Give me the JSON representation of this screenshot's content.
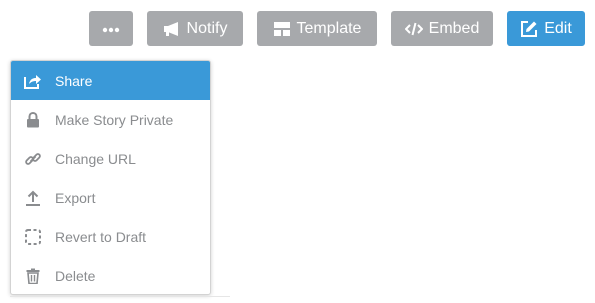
{
  "toolbar": {
    "more_icon": "ellipsis-icon",
    "notify": {
      "label": "Notify",
      "icon": "megaphone-icon"
    },
    "template": {
      "label": "Template",
      "icon": "layout-icon"
    },
    "embed": {
      "label": "Embed",
      "icon": "code-icon"
    },
    "edit": {
      "label": "Edit",
      "icon": "edit-icon"
    }
  },
  "menu": {
    "items": [
      {
        "label": "Share",
        "icon": "share-icon",
        "active": true
      },
      {
        "label": "Make Story Private",
        "icon": "lock-icon"
      },
      {
        "label": "Change URL",
        "icon": "link-icon"
      },
      {
        "label": "Export",
        "icon": "upload-icon"
      },
      {
        "label": "Revert to Draft",
        "icon": "dashed-square-icon"
      },
      {
        "label": "Delete",
        "icon": "trash-icon"
      }
    ]
  },
  "colors": {
    "button_gray": "#a7a9ac",
    "accent_blue": "#3a99d8",
    "menu_text": "#8a8c8f"
  }
}
